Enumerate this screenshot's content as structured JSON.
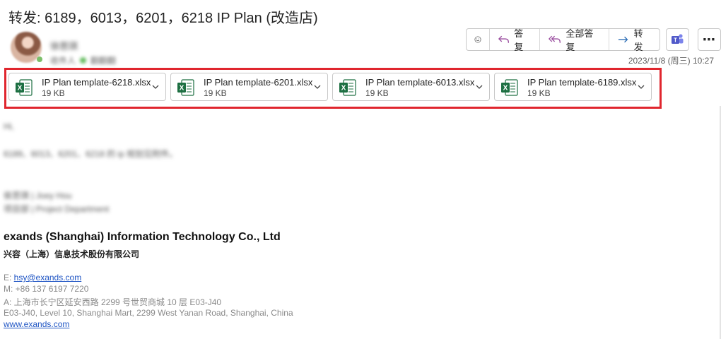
{
  "subject": "转发: 6189，6013，6201，6218 IP Plan (改造店)",
  "sender": {
    "name": "徐思琪",
    "recipient_line": "收件人",
    "status": "翻翻翻"
  },
  "actions": {
    "reply": "答复",
    "reply_all": "全部答复",
    "forward": "转发",
    "more": "⋯"
  },
  "date": "2023/11/8 (周三) 10:27",
  "attachments": [
    {
      "name": "IP Plan template-6218.xlsx",
      "size": "19 KB"
    },
    {
      "name": "IP Plan template-6201.xlsx",
      "size": "19 KB"
    },
    {
      "name": "IP Plan template-6013.xlsx",
      "size": "19 KB"
    },
    {
      "name": "IP Plan template-6189.xlsx",
      "size": "19 KB"
    }
  ],
  "body": {
    "greeting": "Hi,",
    "line1": "6189、6013、6201、6218 的 ip 规划见附件。",
    "sig_name": "侯思琪 | Joey Hou",
    "sig_dept": "项目部 | Project Department"
  },
  "signature": {
    "company": "exands (Shanghai) Information Technology Co., Ltd",
    "company_cn": "兴容（上海）信息技术股份有限公司",
    "email_label": "E: ",
    "email": "hsy@exands.com",
    "mobile": "M: +86 137 6197 7220",
    "address_cn": "A: 上海市长宁区延安西路 2299 号世贸商城 10 层 E03-J40",
    "address_en": "E03-J40, Level 10, Shanghai Mart, 2299 West Yanan Road, Shanghai, China",
    "website": "www.exands.com"
  },
  "colors": {
    "highlight": "#e0262e",
    "excel_green": "#1d6f42",
    "link": "#1f55c4"
  }
}
